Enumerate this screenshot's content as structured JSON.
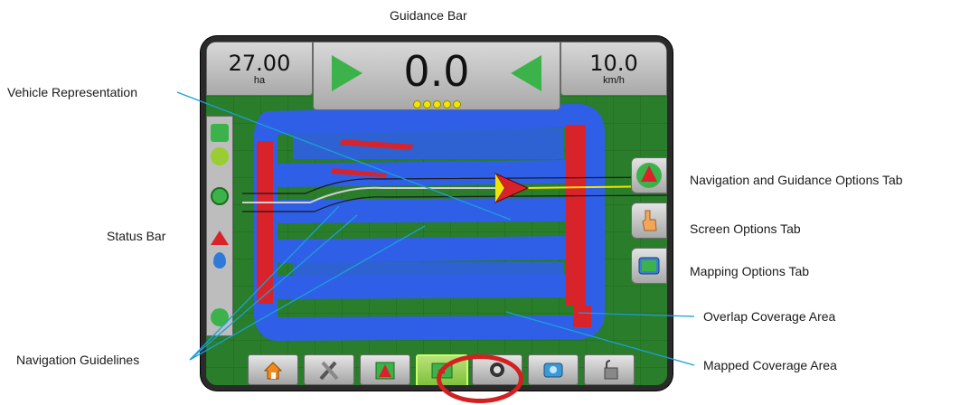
{
  "callouts": {
    "guidance_bar": "Guidance Bar",
    "vehicle_representation": "Vehicle Representation",
    "status_bar": "Status Bar",
    "navigation_guidelines": "Navigation Guidelines",
    "navigation_guidance_tab": "Navigation and Guidance Options Tab",
    "screen_options_tab": "Screen Options Tab",
    "mapping_options_tab": "Mapping Options Tab",
    "overlap_coverage": "Overlap Coverage Area",
    "mapped_coverage": "Mapped Coverage Area"
  },
  "guidance": {
    "area_value": "27.00",
    "area_unit": "ha",
    "cross_track": "0.0",
    "speed_value": "10.0",
    "speed_unit": "km/h"
  },
  "icons": {
    "steer_left": "steer-left-arrow-icon",
    "steer_right": "steer-right-arrow-icon",
    "lightbar": "lightbar-dots-icon",
    "home": "home-icon",
    "tools": "tools-icon",
    "job": "job-icon",
    "nav": "navigation-mode-icon",
    "gps": "gps-icon",
    "camera": "camera-icon",
    "unlock": "unlock-icon"
  },
  "colors": {
    "field": "#2a7d2a",
    "mapped": "#2f5fe6",
    "overlap": "#d8232a",
    "highlight": "#d32020"
  }
}
